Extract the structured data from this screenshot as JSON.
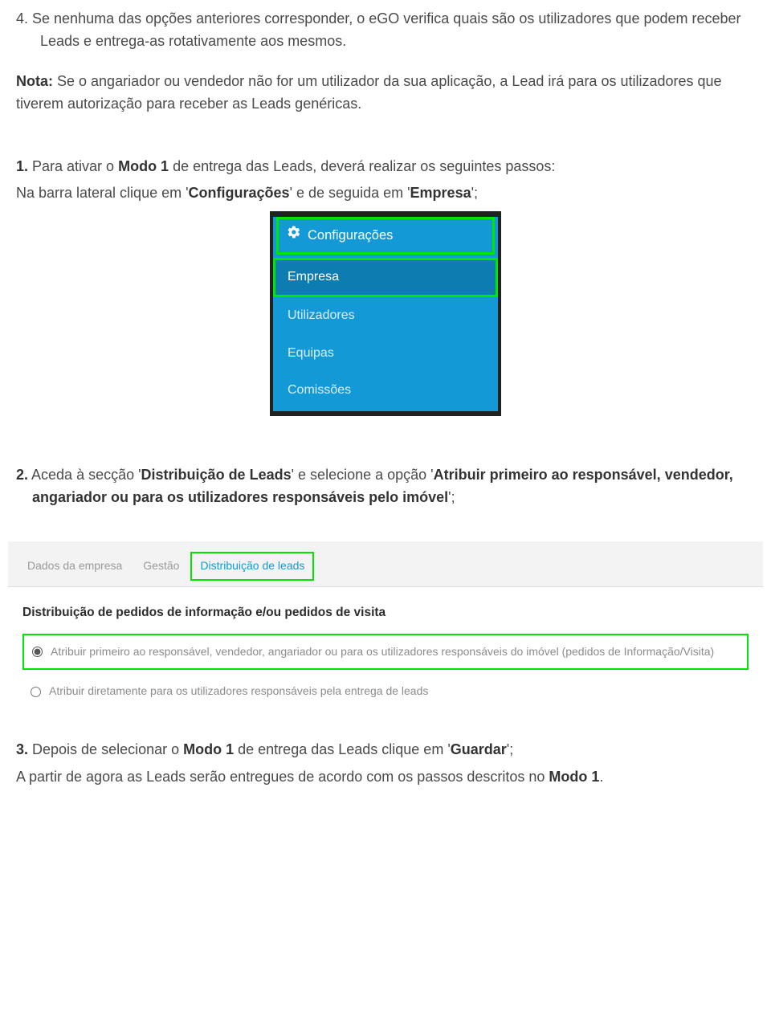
{
  "p4_prefix": "4. ",
  "p4_body": "Se nenhuma das opções anteriores corresponder, o eGO verifica quais são os utilizadores que podem receber Leads e entrega-as rotativamente aos mesmos.",
  "nota_label": "Nota:",
  "nota_body": " Se o angariador ou vendedor não for um utilizador da sua aplicação, a Lead irá para os utilizadores que tiverem autorização para receber as Leads genéricas.",
  "s1_num": "1.",
  "s1_a": " Para ativar o ",
  "s1_b": "Modo 1",
  "s1_c": " de entrega das Leads, deverá realizar os seguintes passos:",
  "s1_line2_a": "Na barra lateral clique em '",
  "s1_line2_b": "Configurações",
  "s1_line2_c": "' e de seguida em '",
  "s1_line2_d": "Empresa",
  "s1_line2_e": "';",
  "sidebar": {
    "config": "Configurações",
    "empresa": "Empresa",
    "utilizadores": "Utilizadores",
    "equipas": "Equipas",
    "comissoes": "Comissões"
  },
  "s2_num": "2.",
  "s2_a": " Aceda à secção '",
  "s2_b": "Distribuição de Leads",
  "s2_c": "' e selecione a opção '",
  "s2_d": "Atribuir primeiro ao responsável, vendedor, angariador ou para os utilizadores responsáveis pelo imóvel",
  "s2_e": "';",
  "tabs": {
    "dados": "Dados da empresa",
    "gestao": "Gestão",
    "distrib": "Distribuição de leads"
  },
  "panel": {
    "title": "Distribuição de pedidos de informação e/ou pedidos de visita",
    "opt1": "Atribuir primeiro ao responsável, vendedor, angariador ou para os utilizadores responsáveis do imóvel (pedidos de Informação/Visita)",
    "opt2": "Atribuir diretamente para os utilizadores responsáveis pela entrega de leads"
  },
  "s3_num": "3.",
  "s3_a": " Depois de selecionar o ",
  "s3_b": "Modo 1",
  "s3_c": " de entrega das Leads clique em '",
  "s3_d": "Guardar",
  "s3_e": "';",
  "s3_line2_a": "A partir de agora as Leads serão entregues de acordo com os passos descritos no ",
  "s3_line2_b": "Modo 1",
  "s3_line2_c": "."
}
